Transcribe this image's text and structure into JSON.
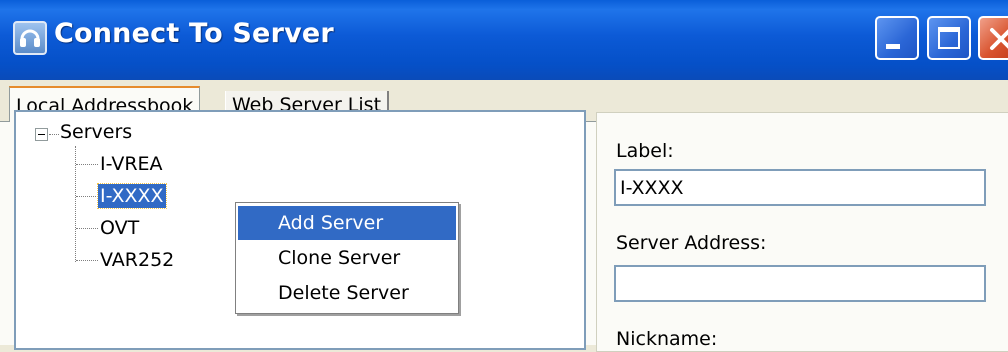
{
  "window": {
    "title": "Connect To Server",
    "app_icon": "headset-icon",
    "controls": [
      "minimize-icon",
      "maximize-icon",
      "close-icon"
    ]
  },
  "tabs": [
    {
      "label": "Local Addressbook",
      "active": true
    },
    {
      "label": "Web Server List",
      "active": false
    }
  ],
  "tree": {
    "root": {
      "label": "Servers",
      "expanded": true
    },
    "children": [
      {
        "label": "I-VREA",
        "selected": false
      },
      {
        "label": "I-XXXX",
        "selected": true
      },
      {
        "label": "OVT",
        "selected": false
      },
      {
        "label": "VAR252",
        "selected": false
      }
    ]
  },
  "context_menu": {
    "items": [
      {
        "label": "Add Server",
        "highlighted": true
      },
      {
        "label": "Clone Server",
        "highlighted": false
      },
      {
        "label": "Delete Server",
        "highlighted": false
      }
    ]
  },
  "form": {
    "label_caption": "Label:",
    "label_value": "I-XXXX",
    "server_address_caption": "Server Address:",
    "server_address_value": "",
    "nickname_caption": "Nickname:"
  },
  "colors": {
    "titlebar_blue": "#0550c8",
    "selection_blue": "#316ac5",
    "tab_highlight": "#e68b2c",
    "close_red": "#d9542f"
  }
}
